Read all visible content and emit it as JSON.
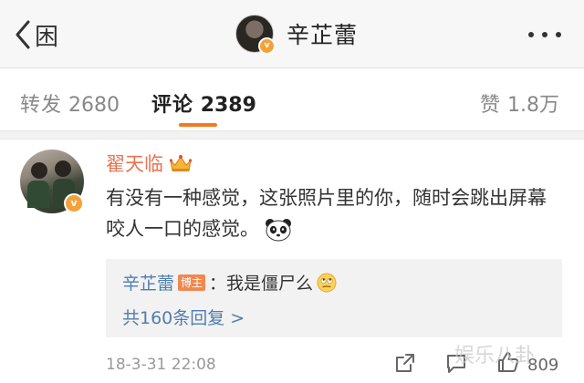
{
  "header": {
    "back_label": "困",
    "title": "辛芷蕾",
    "avatar_badge": "v"
  },
  "tabs": {
    "repost": {
      "label": "转发",
      "count": "2680"
    },
    "comment": {
      "label": "评论",
      "count": "2389"
    },
    "like": {
      "label": "赞",
      "count": "1.8万"
    }
  },
  "comment": {
    "author": "翟天临",
    "avatar_badge": "v",
    "text": "有没有一种感觉，这张照片里的你，随时会跳出屏幕咬人一口的感觉。",
    "reply": {
      "author": "辛芷蕾",
      "host_tag": "博主",
      "text": "：我是僵尸么"
    },
    "more_replies": "共160条回复 >",
    "time": "18-3-31 22:08",
    "like_count": "809"
  },
  "watermark": "娱乐八卦",
  "colors": {
    "accent_orange": "#f07a22",
    "author_name": "#eb7350",
    "link_blue": "#507daf"
  }
}
